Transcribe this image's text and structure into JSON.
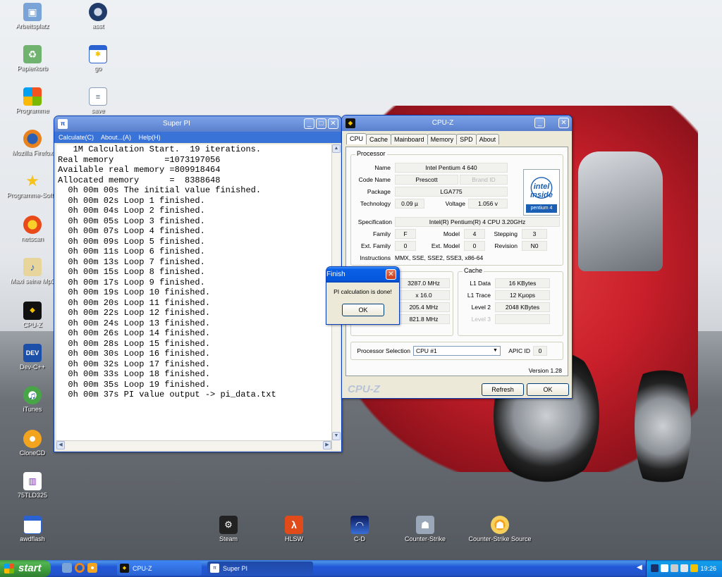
{
  "desktop": {
    "icons_left": [
      {
        "label": "Arbeitsplatz",
        "icon": "computer-icon"
      },
      {
        "label": "Papierkorb",
        "icon": "recycle-bin-icon"
      },
      {
        "label": "Programme",
        "icon": "programs-icon"
      },
      {
        "label": "Mozilla Firefox",
        "icon": "firefox-icon"
      },
      {
        "label": "Programme-Softw",
        "icon": "star-shortcut-icon"
      },
      {
        "label": "netscan",
        "icon": "netscan-icon"
      },
      {
        "label": "Maxi seine Mp3",
        "icon": "mp3-folder-icon"
      },
      {
        "label": "CPU-Z",
        "icon": "cpu-icon"
      },
      {
        "label": "Dev-C++",
        "icon": "devcpp-icon"
      },
      {
        "label": "iTunes",
        "icon": "itunes-icon"
      },
      {
        "label": "CloneCD",
        "icon": "clonecd-icon"
      },
      {
        "label": "75TLD325",
        "icon": "chart-file-icon"
      },
      {
        "label": "awdflash",
        "icon": "window-app-icon"
      }
    ],
    "icons_second": [
      {
        "label": "asst",
        "icon": "steam-circle-icon"
      },
      {
        "label": "go",
        "icon": "app-window-icon"
      },
      {
        "label": "save",
        "icon": "text-file-icon"
      }
    ],
    "icons_bottom": [
      {
        "label": "Steam",
        "icon": "steam-icon"
      },
      {
        "label": "HLSW",
        "icon": "hlsw-icon"
      },
      {
        "label": "C-D",
        "icon": "cd-icon"
      },
      {
        "label": "Counter-Strike",
        "icon": "counter-strike-icon"
      },
      {
        "label": "Counter-Strike Source",
        "icon": "counter-strike-source-icon"
      }
    ]
  },
  "superpi": {
    "title": "Super PI",
    "menu": [
      "Calculate(C)",
      "About...(A)",
      "Help(H)"
    ],
    "output": "   1M Calculation Start.  19 iterations.\nReal memory          =1073197056\nAvailable real memory =809918464\nAllocated memory      =  8388648\n  0h 00m 00s The initial value finished.\n  0h 00m 02s Loop 1 finished.\n  0h 00m 04s Loop 2 finished.\n  0h 00m 05s Loop 3 finished.\n  0h 00m 07s Loop 4 finished.\n  0h 00m 09s Loop 5 finished.\n  0h 00m 11s Loop 6 finished.\n  0h 00m 13s Loop 7 finished.\n  0h 00m 15s Loop 8 finished.\n  0h 00m 17s Loop 9 finished.\n  0h 00m 19s Loop 10 finished.\n  0h 00m 20s Loop 11 finished.\n  0h 00m 22s Loop 12 finished.\n  0h 00m 24s Loop 13 finished.\n  0h 00m 26s Loop 14 finished.\n  0h 00m 28s Loop 15 finished.\n  0h 00m 30s Loop 16 finished.\n  0h 00m 32s Loop 17 finished.\n  0h 00m 33s Loop 18 finished.\n  0h 00m 35s Loop 19 finished.\n  0h 00m 37s PI value output -> pi_data.txt"
  },
  "cpuz": {
    "title": "CPU-Z",
    "tabs": [
      "CPU",
      "Cache",
      "Mainboard",
      "Memory",
      "SPD",
      "About"
    ],
    "processor_group": "Processor",
    "name_label": "Name",
    "name": "Intel Pentium 4 640",
    "codename_label": "Code Name",
    "codename": "Prescott",
    "brandid": "Brand ID",
    "package_label": "Package",
    "package": "LGA775",
    "technology_label": "Technology",
    "technology": "0.09 µ",
    "voltage_label": "Voltage",
    "voltage": "1.056 v",
    "spec_label": "Specification",
    "spec": "Intel(R) Pentium(R) 4 CPU 3.20GHz",
    "family_label": "Family",
    "family": "F",
    "model_label": "Model",
    "model": "4",
    "stepping_label": "Stepping",
    "stepping": "3",
    "extfamily_label": "Ext. Family",
    "extfamily": "0",
    "extmodel_label": "Ext. Model",
    "extmodel": "0",
    "revision_label": "Revision",
    "revision": "N0",
    "instructions_label": "Instructions",
    "instructions": "MMX, SSE, SSE2, SSE3, x86-64",
    "intel_logo_text": "intel inside",
    "intel_logo_brand": "pentium 4",
    "clocks": [
      "3287.0 MHz",
      "x 16.0",
      "205.4 MHz",
      "821.8 MHz"
    ],
    "cache_group": "Cache",
    "l1data_label": "L1 Data",
    "l1data": "16 KBytes",
    "l1trace_label": "L1 Trace",
    "l1trace": "12 Kµops",
    "level2_label": "Level 2",
    "level2": "2048 KBytes",
    "level3_label": "Level 3",
    "procsel_label": "Processor Selection",
    "procsel": "CPU #1",
    "apicid_label": "APIC ID",
    "apicid": "0",
    "version": "Version 1.28",
    "logo": "CPU-Z",
    "refresh": "Refresh",
    "ok": "OK"
  },
  "finish": {
    "title": "Finish",
    "message": "PI calculation is done!",
    "ok": "OK"
  },
  "taskbar": {
    "start": "start",
    "tasks": [
      {
        "label": "CPU-Z",
        "icon": "cpu-icon"
      },
      {
        "label": "Super PI",
        "icon": "superpi-icon"
      }
    ],
    "clock": "19:26"
  },
  "colors": {
    "xp_blue": "#0558dc",
    "start_green": "#3c9b3c",
    "car_red": "#c81f2a"
  }
}
